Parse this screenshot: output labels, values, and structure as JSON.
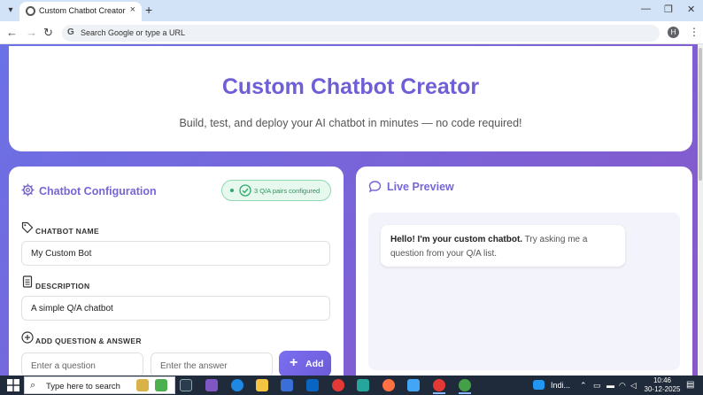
{
  "browser": {
    "tab_title": "Custom Chatbot Creator",
    "tab_close": "×",
    "new_tab": "+",
    "omnibox_placeholder": "Search Google or type a URL",
    "profile_initial": "H"
  },
  "hero": {
    "title": "Custom Chatbot Creator",
    "subtitle": "Build, test, and deploy your AI chatbot in minutes — no code required!"
  },
  "config": {
    "title": "Chatbot Configuration",
    "badge": "3 Q/A pairs configured",
    "name_label": "CHATBOT NAME",
    "name_value": "My Custom Bot",
    "desc_label": "DESCRIPTION",
    "desc_value": "A simple Q/A chatbot",
    "qa_label": "ADD QUESTION & ANSWER",
    "question_placeholder": "Enter a question",
    "answer_placeholder": "Enter the answer",
    "add_button": "Add"
  },
  "preview": {
    "title": "Live Preview",
    "message_bold": "Hello! I'm your custom chatbot.",
    "message_rest": " Try asking me a question from your Q/A list."
  },
  "taskbar": {
    "search_placeholder": "Type here to search",
    "language": "Indi...",
    "time": "10:46",
    "date": "30-12-2025"
  },
  "colors": {
    "accent": "#7566d6",
    "gradient_start": "#6a72e6",
    "gradient_end": "#8a58c8",
    "badge_green": "#2e8f5c"
  }
}
